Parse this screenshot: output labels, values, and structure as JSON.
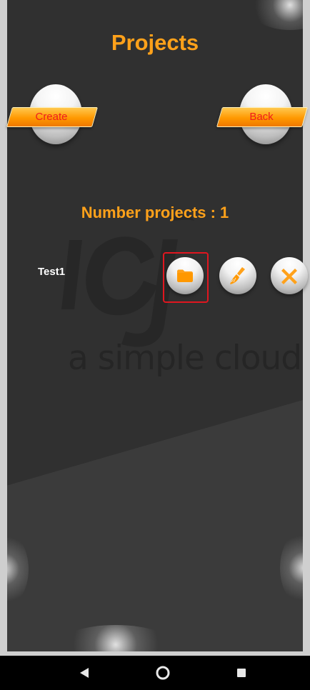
{
  "header": {
    "title": "Projects"
  },
  "actions": {
    "create_label": "Create",
    "back_label": "Back"
  },
  "summary": {
    "label": "Number projects : 1"
  },
  "projects": [
    {
      "name": "Test1",
      "buttons": [
        {
          "icon": "folder-icon",
          "color": "#ffa11a",
          "selected": true
        },
        {
          "icon": "broom-icon",
          "color": "#ffa11a",
          "selected": false
        },
        {
          "icon": "close-icon",
          "color": "#ffa11a",
          "selected": false
        }
      ]
    }
  ],
  "watermark": {
    "logo": "icj",
    "tagline": "a simple cloud"
  },
  "navigation": {
    "items": [
      {
        "icon": "back-triangle-icon"
      },
      {
        "icon": "home-circle-icon"
      },
      {
        "icon": "recent-square-icon"
      }
    ]
  },
  "colors": {
    "accent": "#ffa11a",
    "highlight": "#e0161f",
    "button_text": "#ef1d1d",
    "background": "#303030"
  }
}
